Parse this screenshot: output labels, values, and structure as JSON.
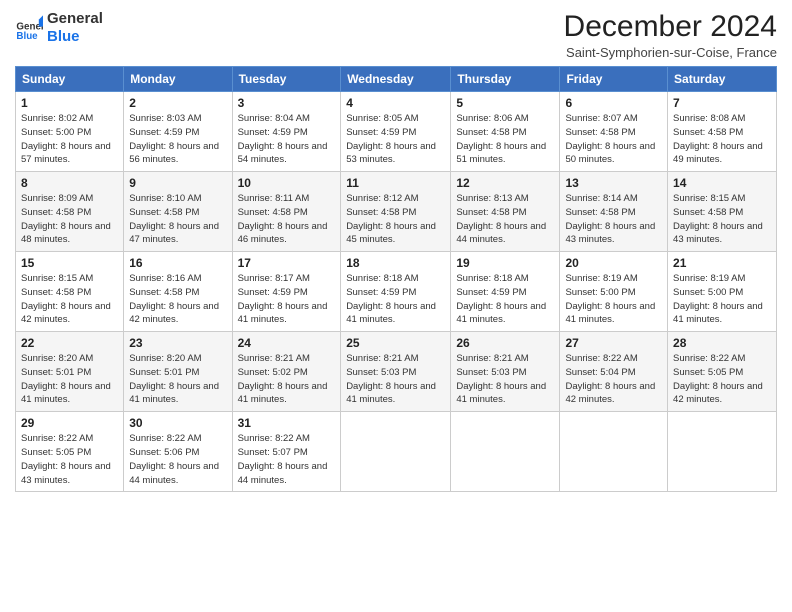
{
  "logo": {
    "line1": "General",
    "line2": "Blue"
  },
  "header": {
    "title": "December 2024",
    "subtitle": "Saint-Symphorien-sur-Coise, France"
  },
  "days_of_week": [
    "Sunday",
    "Monday",
    "Tuesday",
    "Wednesday",
    "Thursday",
    "Friday",
    "Saturday"
  ],
  "weeks": [
    [
      {
        "day": "1",
        "sunrise": "Sunrise: 8:02 AM",
        "sunset": "Sunset: 5:00 PM",
        "daylight": "Daylight: 8 hours and 57 minutes."
      },
      {
        "day": "2",
        "sunrise": "Sunrise: 8:03 AM",
        "sunset": "Sunset: 4:59 PM",
        "daylight": "Daylight: 8 hours and 56 minutes."
      },
      {
        "day": "3",
        "sunrise": "Sunrise: 8:04 AM",
        "sunset": "Sunset: 4:59 PM",
        "daylight": "Daylight: 8 hours and 54 minutes."
      },
      {
        "day": "4",
        "sunrise": "Sunrise: 8:05 AM",
        "sunset": "Sunset: 4:59 PM",
        "daylight": "Daylight: 8 hours and 53 minutes."
      },
      {
        "day": "5",
        "sunrise": "Sunrise: 8:06 AM",
        "sunset": "Sunset: 4:58 PM",
        "daylight": "Daylight: 8 hours and 51 minutes."
      },
      {
        "day": "6",
        "sunrise": "Sunrise: 8:07 AM",
        "sunset": "Sunset: 4:58 PM",
        "daylight": "Daylight: 8 hours and 50 minutes."
      },
      {
        "day": "7",
        "sunrise": "Sunrise: 8:08 AM",
        "sunset": "Sunset: 4:58 PM",
        "daylight": "Daylight: 8 hours and 49 minutes."
      }
    ],
    [
      {
        "day": "8",
        "sunrise": "Sunrise: 8:09 AM",
        "sunset": "Sunset: 4:58 PM",
        "daylight": "Daylight: 8 hours and 48 minutes."
      },
      {
        "day": "9",
        "sunrise": "Sunrise: 8:10 AM",
        "sunset": "Sunset: 4:58 PM",
        "daylight": "Daylight: 8 hours and 47 minutes."
      },
      {
        "day": "10",
        "sunrise": "Sunrise: 8:11 AM",
        "sunset": "Sunset: 4:58 PM",
        "daylight": "Daylight: 8 hours and 46 minutes."
      },
      {
        "day": "11",
        "sunrise": "Sunrise: 8:12 AM",
        "sunset": "Sunset: 4:58 PM",
        "daylight": "Daylight: 8 hours and 45 minutes."
      },
      {
        "day": "12",
        "sunrise": "Sunrise: 8:13 AM",
        "sunset": "Sunset: 4:58 PM",
        "daylight": "Daylight: 8 hours and 44 minutes."
      },
      {
        "day": "13",
        "sunrise": "Sunrise: 8:14 AM",
        "sunset": "Sunset: 4:58 PM",
        "daylight": "Daylight: 8 hours and 43 minutes."
      },
      {
        "day": "14",
        "sunrise": "Sunrise: 8:15 AM",
        "sunset": "Sunset: 4:58 PM",
        "daylight": "Daylight: 8 hours and 43 minutes."
      }
    ],
    [
      {
        "day": "15",
        "sunrise": "Sunrise: 8:15 AM",
        "sunset": "Sunset: 4:58 PM",
        "daylight": "Daylight: 8 hours and 42 minutes."
      },
      {
        "day": "16",
        "sunrise": "Sunrise: 8:16 AM",
        "sunset": "Sunset: 4:58 PM",
        "daylight": "Daylight: 8 hours and 42 minutes."
      },
      {
        "day": "17",
        "sunrise": "Sunrise: 8:17 AM",
        "sunset": "Sunset: 4:59 PM",
        "daylight": "Daylight: 8 hours and 41 minutes."
      },
      {
        "day": "18",
        "sunrise": "Sunrise: 8:18 AM",
        "sunset": "Sunset: 4:59 PM",
        "daylight": "Daylight: 8 hours and 41 minutes."
      },
      {
        "day": "19",
        "sunrise": "Sunrise: 8:18 AM",
        "sunset": "Sunset: 4:59 PM",
        "daylight": "Daylight: 8 hours and 41 minutes."
      },
      {
        "day": "20",
        "sunrise": "Sunrise: 8:19 AM",
        "sunset": "Sunset: 5:00 PM",
        "daylight": "Daylight: 8 hours and 41 minutes."
      },
      {
        "day": "21",
        "sunrise": "Sunrise: 8:19 AM",
        "sunset": "Sunset: 5:00 PM",
        "daylight": "Daylight: 8 hours and 41 minutes."
      }
    ],
    [
      {
        "day": "22",
        "sunrise": "Sunrise: 8:20 AM",
        "sunset": "Sunset: 5:01 PM",
        "daylight": "Daylight: 8 hours and 41 minutes."
      },
      {
        "day": "23",
        "sunrise": "Sunrise: 8:20 AM",
        "sunset": "Sunset: 5:01 PM",
        "daylight": "Daylight: 8 hours and 41 minutes."
      },
      {
        "day": "24",
        "sunrise": "Sunrise: 8:21 AM",
        "sunset": "Sunset: 5:02 PM",
        "daylight": "Daylight: 8 hours and 41 minutes."
      },
      {
        "day": "25",
        "sunrise": "Sunrise: 8:21 AM",
        "sunset": "Sunset: 5:03 PM",
        "daylight": "Daylight: 8 hours and 41 minutes."
      },
      {
        "day": "26",
        "sunrise": "Sunrise: 8:21 AM",
        "sunset": "Sunset: 5:03 PM",
        "daylight": "Daylight: 8 hours and 41 minutes."
      },
      {
        "day": "27",
        "sunrise": "Sunrise: 8:22 AM",
        "sunset": "Sunset: 5:04 PM",
        "daylight": "Daylight: 8 hours and 42 minutes."
      },
      {
        "day": "28",
        "sunrise": "Sunrise: 8:22 AM",
        "sunset": "Sunset: 5:05 PM",
        "daylight": "Daylight: 8 hours and 42 minutes."
      }
    ],
    [
      {
        "day": "29",
        "sunrise": "Sunrise: 8:22 AM",
        "sunset": "Sunset: 5:05 PM",
        "daylight": "Daylight: 8 hours and 43 minutes."
      },
      {
        "day": "30",
        "sunrise": "Sunrise: 8:22 AM",
        "sunset": "Sunset: 5:06 PM",
        "daylight": "Daylight: 8 hours and 44 minutes."
      },
      {
        "day": "31",
        "sunrise": "Sunrise: 8:22 AM",
        "sunset": "Sunset: 5:07 PM",
        "daylight": "Daylight: 8 hours and 44 minutes."
      },
      null,
      null,
      null,
      null
    ]
  ]
}
